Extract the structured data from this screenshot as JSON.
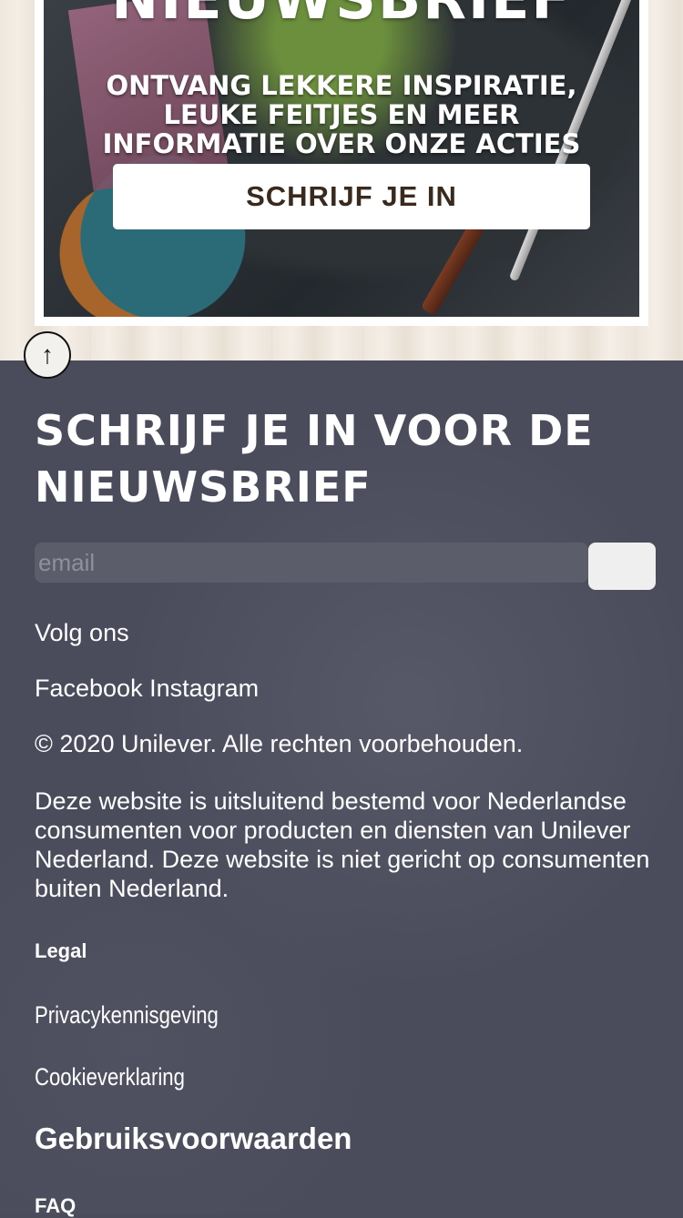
{
  "promo": {
    "title": "NIEUWSBRIEF",
    "subtitle_lines": [
      "ONTVANG LEKKERE INSPIRATIE,",
      "LEUKE FEITJES EN MEER",
      "INFORMATIE OVER ONZE ACTIES"
    ],
    "cta_label": "SCHRIJF JE IN"
  },
  "back_to_top": {
    "icon": "arrow-up-icon",
    "glyph": "↑"
  },
  "newsletter": {
    "title": "SCHRIJF JE IN VOOR DE NIEUWSBRIEF",
    "email_placeholder": "email"
  },
  "footer": {
    "follow_label": "Volg ons",
    "social": [
      "Facebook",
      "Instagram"
    ],
    "copyright": "© 2020 Unilever. Alle rechten voorbehouden.",
    "disclaimer": "Deze website is uitsluitend bestemd voor Nederlandse consumenten voor producten en diensten van Unilever Nederland. Deze website is niet gericht op consumenten buiten Nederland.",
    "legal_heading": "Legal",
    "links": {
      "privacy": "Privacykennisgeving",
      "cookie": "Cookieverklaring",
      "terms": "Gebruiksvoorwaarden",
      "faq": "FAQ"
    }
  },
  "colors": {
    "footer_bg": "#4a4c5c",
    "cta_text": "#3a2a1e"
  }
}
